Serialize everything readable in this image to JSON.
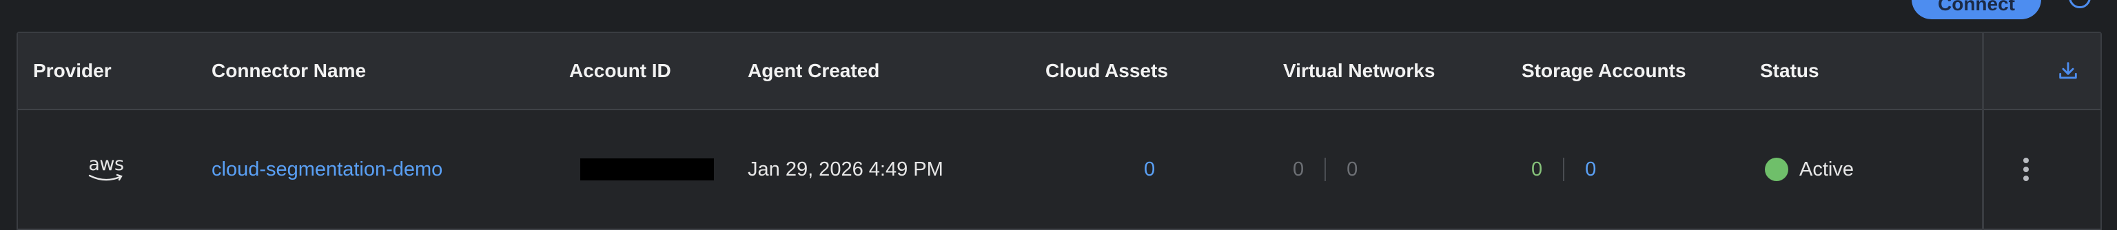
{
  "top_bar": {
    "connect_button_label": "Connect"
  },
  "table": {
    "headers": {
      "provider": "Provider",
      "connector_name": "Connector Name",
      "account_id": "Account ID",
      "agent_created": "Agent Created",
      "cloud_assets": "Cloud Assets",
      "virtual_networks": "Virtual Networks",
      "storage_accounts": "Storage Accounts",
      "status": "Status"
    },
    "rows": [
      {
        "provider": "aws",
        "connector_name": "cloud-segmentation-demo",
        "account_id": "",
        "agent_created": "Jan 29, 2026 4:49 PM",
        "cloud_assets": "0",
        "virtual_networks": [
          "0",
          "0"
        ],
        "storage_accounts": [
          "0",
          "0"
        ],
        "status": "Active"
      }
    ]
  },
  "colors": {
    "link": "#5aa0f5",
    "status_active": "#6fbf6a",
    "accent": "#4d8df0"
  },
  "icons": {
    "download": "download-icon",
    "more": "kebab-menu-icon",
    "provider": "aws-logo"
  }
}
